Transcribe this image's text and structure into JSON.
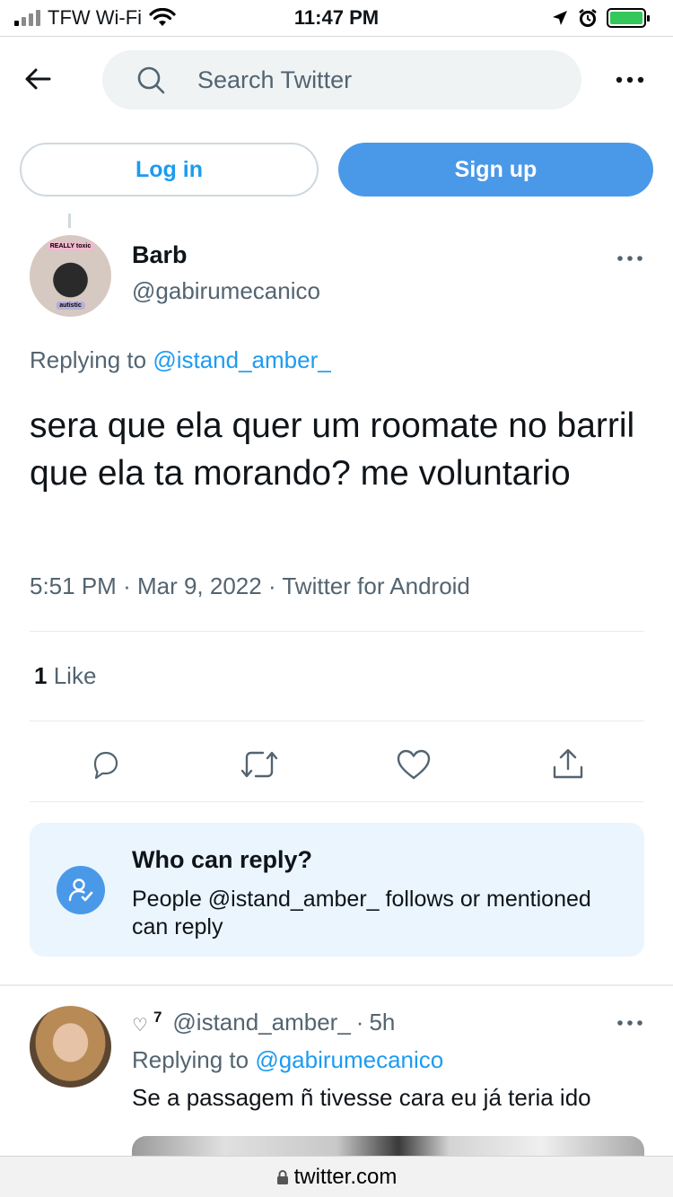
{
  "status_bar": {
    "carrier": "TFW Wi-Fi",
    "time": "11:47 PM"
  },
  "nav": {
    "search_placeholder": "Search Twitter"
  },
  "auth": {
    "login_label": "Log in",
    "signup_label": "Sign up"
  },
  "tweet": {
    "display_name": "Barb",
    "handle": "@gabirumecanico",
    "replying_prefix": "Replying to",
    "replying_to": "@istand_amber_",
    "text": "sera que ela quer um roomate no barril que ela ta morando? me voluntario",
    "time": "5:51 PM",
    "date": "Mar 9, 2022",
    "source": "Twitter for Android",
    "like_count": "1",
    "like_label": "Like",
    "avatar_tag_top": "REALLY toxic",
    "avatar_tag_bottom": "autistic"
  },
  "who_can_reply": {
    "title": "Who can reply?",
    "body": "People @istand_amber_ follows or mentioned can reply"
  },
  "reply": {
    "like_count": "7",
    "handle": "@istand_amber_",
    "time": "5h",
    "replying_prefix": "Replying to",
    "replying_to": "@gabirumecanico",
    "text": "Se a passagem ñ tivesse cara eu já teria ido"
  },
  "browser": {
    "url": "twitter.com"
  },
  "colors": {
    "accent": "#1d9bf0",
    "signup_bg": "#4a99e9",
    "muted_text": "#536471",
    "info_bg": "#eaf5fe",
    "battery": "#34c759"
  },
  "icons": [
    "signal-icon",
    "wifi-icon",
    "location-icon",
    "alarm-icon",
    "battery-icon",
    "back-arrow-icon",
    "search-icon",
    "more-icon",
    "reply-icon",
    "retweet-icon",
    "like-icon",
    "share-icon",
    "person-check-icon",
    "heart-icon",
    "lock-icon"
  ]
}
